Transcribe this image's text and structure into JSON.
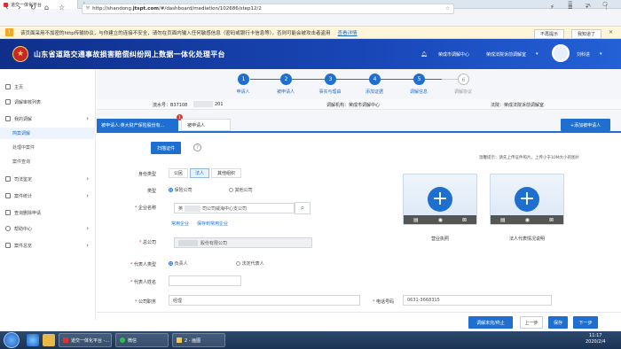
{
  "browser": {
    "tab_title": "道交一体化平台",
    "new_tab": "+",
    "url_prefix": "http://shandong.",
    "url_domain": "jtspt.com",
    "url_path": "/#/dashboard/mediation/102686/step12/2",
    "security_message": "该页面采用不加密的http传输协议，与你建立的连接不安全，请勿在页面内输入任何敏感信息（密码或银行卡信息等），否则可能会被攻击者盗用",
    "security_link": "查看详情",
    "btn_no_prompt": "不再提示",
    "btn_got_it": "我知道了",
    "icons": [
      "back-icon",
      "forward-icon",
      "refresh-icon",
      "home-icon",
      "star-icon",
      "menu-icon"
    ]
  },
  "header": {
    "title": "山东省道路交通事故损害赔偿纠纷网上数据一体化处理平台",
    "item1": "荣成市调解中心",
    "item2": "荣成法院诉前调解室",
    "user": "刘科进",
    "colors": {
      "primary": "#1f6fd0",
      "header_dark": "#0f2f8a"
    }
  },
  "sidebar": {
    "items": [
      {
        "label": "主页"
      },
      {
        "label": "调解审核列表"
      },
      {
        "label": "我的调解"
      },
      {
        "label": "简案调解"
      },
      {
        "label": "处理中案件"
      },
      {
        "label": "案件查询"
      },
      {
        "label": "司法鉴定"
      },
      {
        "label": "案件统计"
      },
      {
        "label": "查询删除申请"
      },
      {
        "label": "帮助中心"
      },
      {
        "label": "案件总览"
      }
    ]
  },
  "steps": [
    {
      "num": "1",
      "label": "申请人"
    },
    {
      "num": "2",
      "label": "被申请人"
    },
    {
      "num": "3",
      "label": "事实与理由"
    },
    {
      "num": "4",
      "label": "添加证据"
    },
    {
      "num": "5",
      "label": "调解信息"
    },
    {
      "num": "6",
      "label": "调解协议"
    }
  ],
  "info": {
    "flow_label": "流水号：B37108",
    "flow_rest": "201",
    "mediator": "调解机构：荣成市调解中心",
    "court": "法院：荣成法院诉前调解室"
  },
  "tabs": {
    "tab1": "被申请人:英大财产保险股份有...",
    "tab1_badge": "1",
    "tab2": "被申请人",
    "add_button": "+添加被申请人"
  },
  "form": {
    "scan_button": "扫描证件",
    "identity_label": "身份类型",
    "identity_options": [
      "公民",
      "法人",
      "其他组织"
    ],
    "type_label": "类型",
    "type_options": [
      "保险公司",
      "其他公司"
    ],
    "company_label": "企业名称",
    "company_value": "英",
    "company_value_rest": "司公司威海中心支公司",
    "common_company": "常用企业",
    "save_common": "保存到常用企业",
    "head_office_label": "总公司",
    "head_office_value": "股份有限公司",
    "rep_type_label": "代表人类型",
    "rep_type_options": [
      "负责人",
      "法定代表人"
    ],
    "rep_name_label": "代表人姓名",
    "rep_name_value": "",
    "position_label": "公司职务",
    "position_value": "经理",
    "phone_label": "电话号码",
    "phone_value": "0631-3668315",
    "upload_hint": "温馨提示：请先上传证件照片，上传小于10M大小的图片",
    "upload1": "营业执照",
    "upload2": "法人代表情况说明"
  },
  "footer": {
    "btn_terminate": "调解未完/终止",
    "btn_prev": "上一步",
    "btn_save": "保存",
    "btn_next": "下一步"
  },
  "taskbar": {
    "win1": "道交一体化平台 -...",
    "win2": "微信",
    "win3": "2 - 画图",
    "time": "11:17",
    "date": "2020/2/4"
  }
}
